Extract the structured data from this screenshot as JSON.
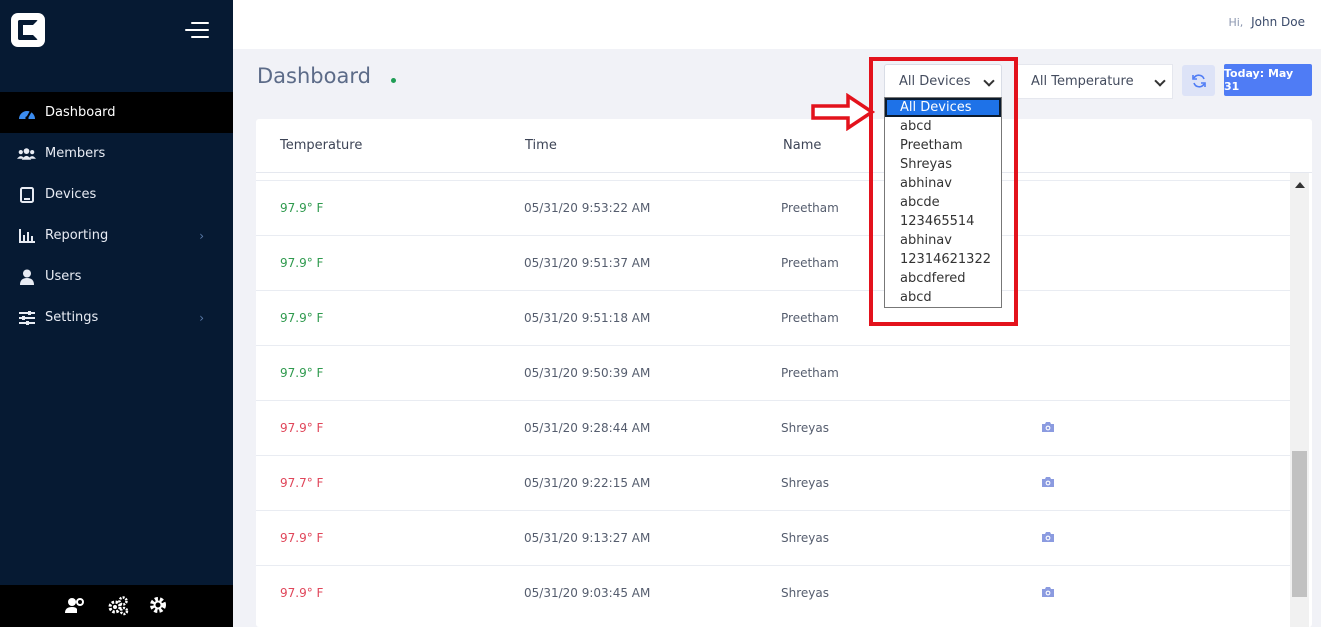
{
  "sidebar": {
    "items": [
      {
        "label": "Dashboard",
        "icon": "gauge-icon",
        "active": true
      },
      {
        "label": "Members",
        "icon": "members-icon"
      },
      {
        "label": "Devices",
        "icon": "tablet-icon"
      },
      {
        "label": "Reporting",
        "icon": "bar-chart-icon",
        "has_submenu": true
      },
      {
        "label": "Users",
        "icon": "user-icon"
      },
      {
        "label": "Settings",
        "icon": "sliders-icon",
        "has_submenu": true
      }
    ],
    "bottom_icons": [
      "user-settings-icon",
      "cogs-icon",
      "gear-icon"
    ]
  },
  "topbar": {
    "greeting_prefix": "Hi,",
    "user_name": "John Doe"
  },
  "header": {
    "title": "Dashboard",
    "device_filter": {
      "selected": "All Devices"
    },
    "temperature_filter": {
      "selected": "All Temperature"
    },
    "today_label": "Today: May 31"
  },
  "dropdown": {
    "options": [
      "All Devices",
      "abcd",
      "Preetham",
      "Shreyas",
      "abhinav",
      "abcde",
      "123465514",
      "abhinav",
      "12314621322",
      "abcdfered",
      "abcd"
    ],
    "selected_index": 0
  },
  "table": {
    "columns": [
      "Temperature",
      "Time",
      "Name"
    ],
    "rows": [
      {
        "temperature": "97.9° F",
        "time": "05/31/20 9:53:22 AM",
        "name": "Preetham",
        "status": "good",
        "photo": false
      },
      {
        "temperature": "97.9° F",
        "time": "05/31/20 9:51:37 AM",
        "name": "Preetham",
        "status": "good",
        "photo": false
      },
      {
        "temperature": "97.9° F",
        "time": "05/31/20 9:51:18 AM",
        "name": "Preetham",
        "status": "good",
        "photo": false
      },
      {
        "temperature": "97.9° F",
        "time": "05/31/20 9:50:39 AM",
        "name": "Preetham",
        "status": "good",
        "photo": false
      },
      {
        "temperature": "97.9° F",
        "time": "05/31/20 9:28:44 AM",
        "name": "Shreyas",
        "status": "bad",
        "photo": true
      },
      {
        "temperature": "97.7° F",
        "time": "05/31/20 9:22:15 AM",
        "name": "Shreyas",
        "status": "bad",
        "photo": true
      },
      {
        "temperature": "97.9° F",
        "time": "05/31/20 9:13:27 AM",
        "name": "Shreyas",
        "status": "bad",
        "photo": true
      },
      {
        "temperature": "97.9° F",
        "time": "05/31/20 9:03:45 AM",
        "name": "Shreyas",
        "status": "bad",
        "photo": true
      }
    ]
  },
  "colors": {
    "sidebar_bg": "#061a33",
    "accent_blue": "#4f7cf5",
    "temp_good": "#2f9a4e",
    "temp_bad": "#e0465a",
    "annotation_red": "#e3121c"
  }
}
